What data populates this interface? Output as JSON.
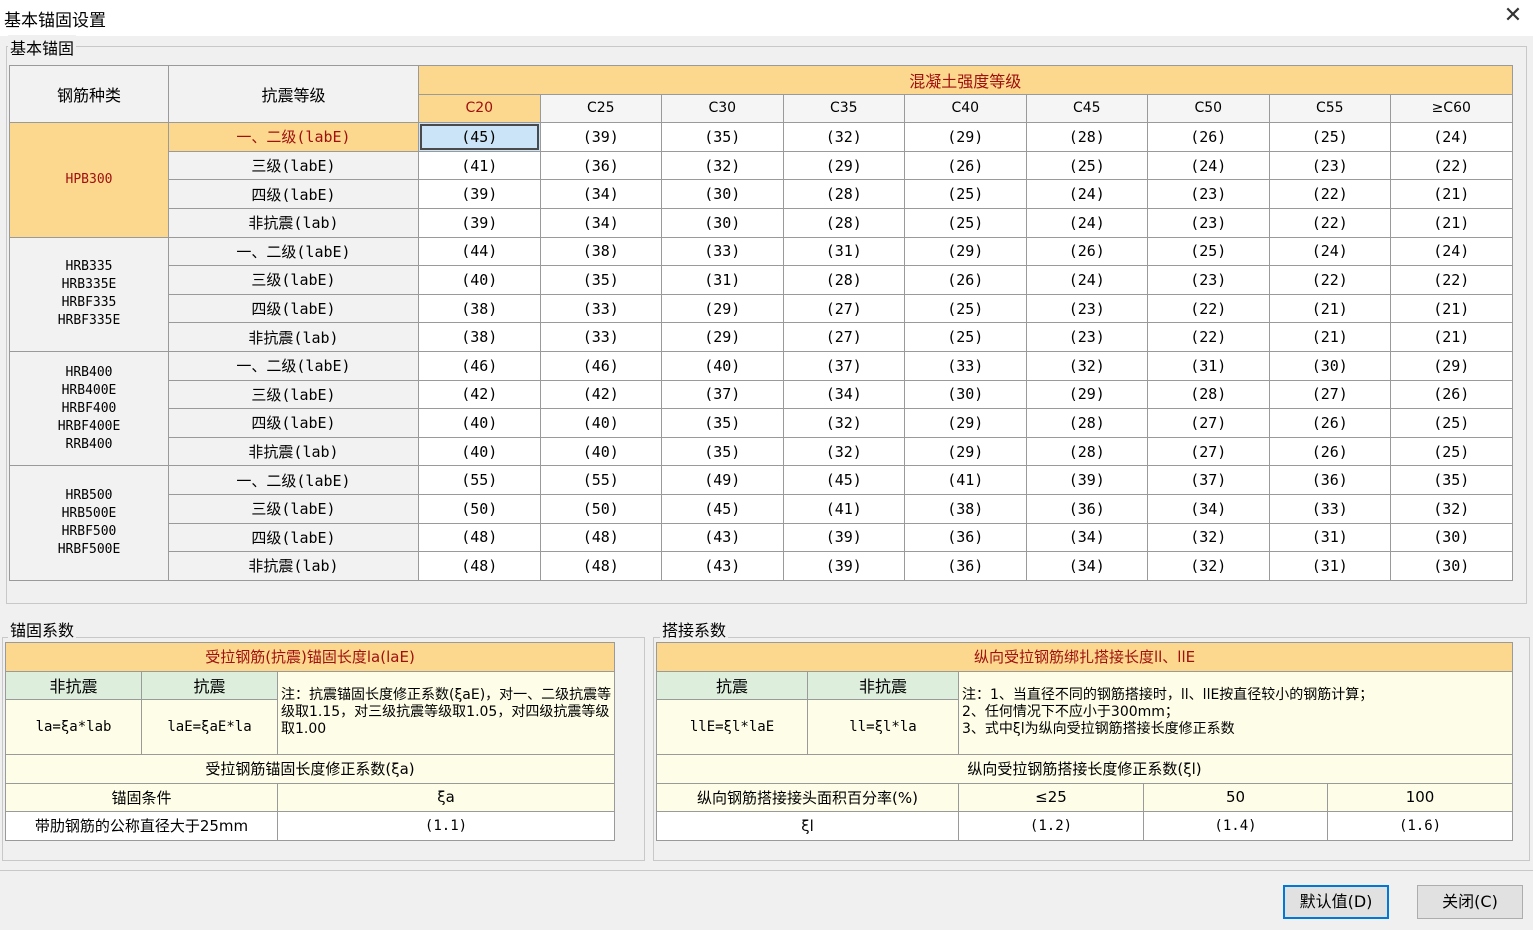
{
  "window": {
    "title": "基本锚固设置"
  },
  "basic": {
    "group_label": "基本锚固",
    "header": {
      "rebar_type": "钢筋种类",
      "seismic_grade": "抗震等级",
      "concrete_strength": "混凝土强度等级"
    },
    "grades": [
      "C20",
      "C25",
      "C30",
      "C35",
      "C40",
      "C45",
      "C50",
      "C55",
      "≥C60"
    ],
    "groups": [
      {
        "rebar": "HPB300",
        "rows": [
          {
            "seismic": "一、二级(labE)",
            "values": [
              "(45)",
              "(39)",
              "(35)",
              "(32)",
              "(29)",
              "(28)",
              "(26)",
              "(25)",
              "(24)"
            ]
          },
          {
            "seismic": "三级(labE)",
            "values": [
              "(41)",
              "(36)",
              "(32)",
              "(29)",
              "(26)",
              "(25)",
              "(24)",
              "(23)",
              "(22)"
            ]
          },
          {
            "seismic": "四级(labE)",
            "values": [
              "(39)",
              "(34)",
              "(30)",
              "(28)",
              "(25)",
              "(24)",
              "(23)",
              "(22)",
              "(21)"
            ]
          },
          {
            "seismic": "非抗震(lab)",
            "values": [
              "(39)",
              "(34)",
              "(30)",
              "(28)",
              "(25)",
              "(24)",
              "(23)",
              "(22)",
              "(21)"
            ]
          }
        ]
      },
      {
        "rebar": "HRB335\nHRB335E\nHRBF335\nHRBF335E",
        "rows": [
          {
            "seismic": "一、二级(labE)",
            "values": [
              "(44)",
              "(38)",
              "(33)",
              "(31)",
              "(29)",
              "(26)",
              "(25)",
              "(24)",
              "(24)"
            ]
          },
          {
            "seismic": "三级(labE)",
            "values": [
              "(40)",
              "(35)",
              "(31)",
              "(28)",
              "(26)",
              "(24)",
              "(23)",
              "(22)",
              "(22)"
            ]
          },
          {
            "seismic": "四级(labE)",
            "values": [
              "(38)",
              "(33)",
              "(29)",
              "(27)",
              "(25)",
              "(23)",
              "(22)",
              "(21)",
              "(21)"
            ]
          },
          {
            "seismic": "非抗震(lab)",
            "values": [
              "(38)",
              "(33)",
              "(29)",
              "(27)",
              "(25)",
              "(23)",
              "(22)",
              "(21)",
              "(21)"
            ]
          }
        ]
      },
      {
        "rebar": "HRB400\nHRB400E\nHRBF400\nHRBF400E\nRRB400",
        "rows": [
          {
            "seismic": "一、二级(labE)",
            "values": [
              "(46)",
              "(46)",
              "(40)",
              "(37)",
              "(33)",
              "(32)",
              "(31)",
              "(30)",
              "(29)"
            ]
          },
          {
            "seismic": "三级(labE)",
            "values": [
              "(42)",
              "(42)",
              "(37)",
              "(34)",
              "(30)",
              "(29)",
              "(28)",
              "(27)",
              "(26)"
            ]
          },
          {
            "seismic": "四级(labE)",
            "values": [
              "(40)",
              "(40)",
              "(35)",
              "(32)",
              "(29)",
              "(28)",
              "(27)",
              "(26)",
              "(25)"
            ]
          },
          {
            "seismic": "非抗震(lab)",
            "values": [
              "(40)",
              "(40)",
              "(35)",
              "(32)",
              "(29)",
              "(28)",
              "(27)",
              "(26)",
              "(25)"
            ]
          }
        ]
      },
      {
        "rebar": "HRB500\nHRB500E\nHRBF500\nHRBF500E",
        "rows": [
          {
            "seismic": "一、二级(labE)",
            "values": [
              "(55)",
              "(55)",
              "(49)",
              "(45)",
              "(41)",
              "(39)",
              "(37)",
              "(36)",
              "(35)"
            ]
          },
          {
            "seismic": "三级(labE)",
            "values": [
              "(50)",
              "(50)",
              "(45)",
              "(41)",
              "(38)",
              "(36)",
              "(34)",
              "(33)",
              "(32)"
            ]
          },
          {
            "seismic": "四级(labE)",
            "values": [
              "(48)",
              "(48)",
              "(43)",
              "(39)",
              "(36)",
              "(34)",
              "(32)",
              "(31)",
              "(30)"
            ]
          },
          {
            "seismic": "非抗震(lab)",
            "values": [
              "(48)",
              "(48)",
              "(43)",
              "(39)",
              "(36)",
              "(34)",
              "(32)",
              "(31)",
              "(30)"
            ]
          }
        ]
      }
    ]
  },
  "anchor": {
    "group_label": "锚固系数",
    "title": "受拉钢筋(抗震)锚固长度la(laE)",
    "col_non_seismic": "非抗震",
    "col_seismic": "抗震",
    "formula_non_seismic": "la=ξa*lab",
    "formula_seismic": "laE=ξaE*la",
    "note": "注：抗震锚固长度修正系数(ξaE)，对一、二级抗震等级取1.15，对三级抗震等级取1.05，对四级抗震等级取1.00",
    "coef_title": "受拉钢筋锚固长度修正系数(ξa)",
    "cond_header": "锚固条件",
    "coef_header": "ξa",
    "cond_row": "带肋钢筋的公称直径大于25mm",
    "cond_value": "(1.1)"
  },
  "lap": {
    "group_label": "搭接系数",
    "title": "纵向受拉钢筋绑扎搭接长度ll、llE",
    "col_seismic": "抗震",
    "col_non_seismic": "非抗震",
    "formula_seismic": "llE=ξl*laE",
    "formula_non_seismic": "ll=ξl*la",
    "note": "注：1、当直径不同的钢筋搭接时，ll、llE按直径较小的钢筋计算；\n2、任何情况下不应小于300mm；\n3、式中ξl为纵向受拉钢筋搭接长度修正系数",
    "coef_title": "纵向受拉钢筋搭接长度修正系数(ξl)",
    "pct_header": "纵向钢筋搭接接头面积百分率(%)",
    "pct_values": [
      "≤25",
      "50",
      "100"
    ],
    "coef_label": "ξl",
    "coef_values": [
      "(1.2)",
      "(1.4)",
      "(1.6)"
    ]
  },
  "buttons": {
    "default": "默认值(D)",
    "close": "关闭(C)"
  }
}
